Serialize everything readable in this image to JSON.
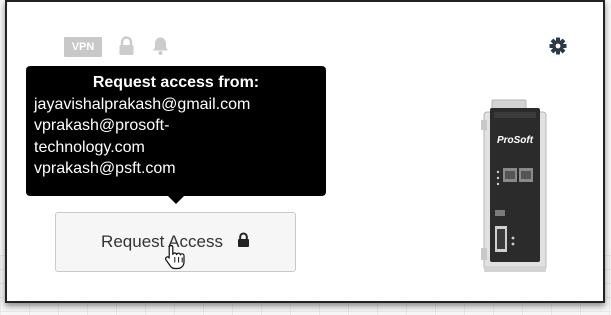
{
  "header": {
    "vpn_badge": "VPN",
    "icons": [
      "lock-icon",
      "bell-icon",
      "gear-icon"
    ]
  },
  "tooltip": {
    "title": "Request access from:",
    "lines": [
      "jayavishalprakash@gmail.com",
      "vprakash@prosoft-",
      "technology.com",
      "vprakash@psft.com"
    ]
  },
  "request_button": {
    "label": "Request Access",
    "icon": "lock-icon"
  },
  "device": {
    "brand": "ProSoft",
    "icon": "device-image"
  },
  "colors": {
    "tooltip_bg": "#000000",
    "button_bg": "#f6f6f6",
    "badge_bg": "#c8c8c8",
    "icon_muted": "#cccccc",
    "gear": "#2b3a46"
  }
}
